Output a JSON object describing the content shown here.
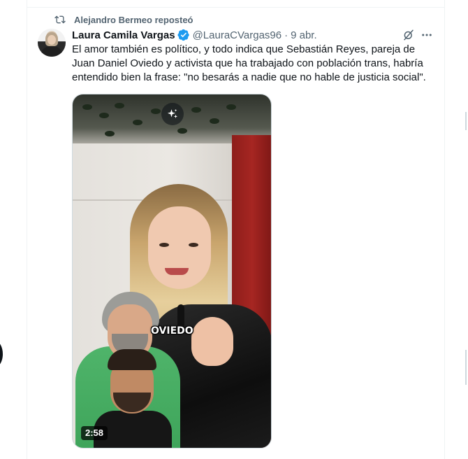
{
  "repost": {
    "icon": "repost-icon",
    "text": "Alejandro Bermeo reposteó"
  },
  "tweet": {
    "author_name": "Laura Camila Vargas",
    "verified_icon": "verified-badge-icon",
    "handle": "@LauraCVargas96",
    "separator": "·",
    "date": "9 abr.",
    "text": "El amor también es político, y todo indica que Sebastián Reyes, pareja de Juan Daniel Oviedo y activista que ha trabajado con población trans, habría entendido bien la frase: \"no besarás a nadie que no hable de justicia social\".",
    "actions": {
      "grok_icon": "grok-icon",
      "more_icon": "more-icon"
    }
  },
  "media": {
    "overlay_text": "OVIEDO",
    "sparkle_icon": "sparkle-icon",
    "duration": "2:58"
  },
  "colors": {
    "text_primary": "#0f1419",
    "text_secondary": "#536471",
    "verified_blue": "#1d9bf0",
    "border": "#eff3f4"
  }
}
